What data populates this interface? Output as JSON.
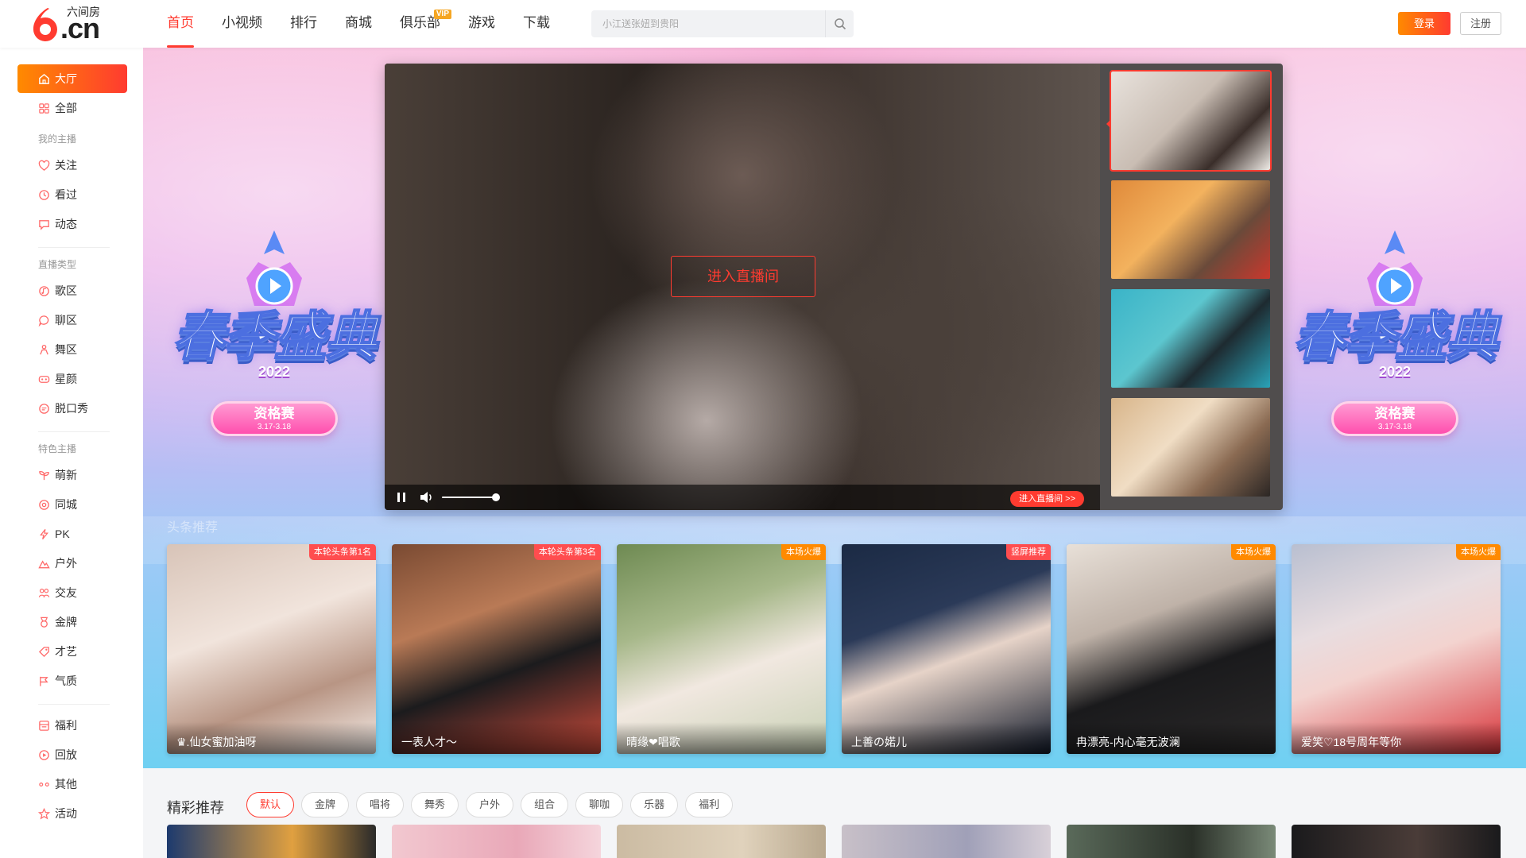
{
  "header": {
    "logo": {
      "sub": "六间房",
      "mark": ".cn"
    },
    "nav": [
      {
        "label": "首页",
        "active": true
      },
      {
        "label": "小视频"
      },
      {
        "label": "排行"
      },
      {
        "label": "商城"
      },
      {
        "label": "俱乐部",
        "badge": "VIP"
      },
      {
        "label": "游戏"
      },
      {
        "label": "下载"
      }
    ],
    "search": {
      "placeholder": "小江送张妞到贵阳"
    },
    "login": "登录",
    "register": "注册"
  },
  "sidebar": {
    "top_items": [
      {
        "label": "大厅",
        "icon": "home-icon",
        "active": true
      },
      {
        "label": "全部",
        "icon": "grid-icon"
      }
    ],
    "groups": [
      {
        "title": "我的主播",
        "items": [
          {
            "label": "关注",
            "icon": "heart-icon"
          },
          {
            "label": "看过",
            "icon": "clock-icon"
          },
          {
            "label": "动态",
            "icon": "message-icon"
          }
        ]
      },
      {
        "title": "直播类型",
        "items": [
          {
            "label": "歌区",
            "icon": "music-icon"
          },
          {
            "label": "聊区",
            "icon": "chat-icon"
          },
          {
            "label": "舞区",
            "icon": "dance-icon"
          },
          {
            "label": "星颜",
            "icon": "mask-icon"
          },
          {
            "label": "脱口秀",
            "icon": "talk-icon"
          }
        ]
      },
      {
        "title": "特色主播",
        "items": [
          {
            "label": "萌新",
            "icon": "sprout-icon"
          },
          {
            "label": "同城",
            "icon": "location-icon"
          },
          {
            "label": "PK",
            "icon": "lightning-icon"
          },
          {
            "label": "户外",
            "icon": "mountain-icon"
          },
          {
            "label": "交友",
            "icon": "friends-icon"
          },
          {
            "label": "金牌",
            "icon": "medal-icon"
          },
          {
            "label": "才艺",
            "icon": "palette-icon"
          },
          {
            "label": "气质",
            "icon": "flag-icon"
          }
        ]
      }
    ],
    "bottom_items": [
      {
        "label": "福利",
        "icon": "gift-icon"
      },
      {
        "label": "回放",
        "icon": "replay-icon"
      },
      {
        "label": "其他",
        "icon": "more-icon"
      },
      {
        "label": "活动",
        "icon": "star-icon"
      }
    ]
  },
  "hero": {
    "festival": {
      "title": "春季盛典",
      "year": "2022",
      "pill_main": "资格赛",
      "pill_date": "3.17-3.18"
    },
    "player": {
      "enter_center": "进入直播间",
      "enter_small": "进入直播间 >>",
      "volume": 0.85
    },
    "section_title": "头条推荐",
    "cards": [
      {
        "name": "♛.仙女蜜加油呀",
        "tag": "本轮头条第1名",
        "tag_color": "red"
      },
      {
        "name": "一表人才～",
        "tag": "本轮头条第3名",
        "tag_color": "red"
      },
      {
        "name": "晴缘❤唱歌",
        "tag": "本场火爆",
        "tag_color": "orange"
      },
      {
        "name": "上善の婼儿",
        "tag": "竖屏推荐",
        "tag_color": "red"
      },
      {
        "name": "冉漂亮-内心毫无波澜",
        "tag": "本场火爆",
        "tag_color": "orange"
      },
      {
        "name": "爱笑♡18号周年等你",
        "tag": "本场火爆",
        "tag_color": "orange"
      }
    ]
  },
  "recommend": {
    "title": "精彩推荐",
    "filters": [
      {
        "label": "默认",
        "active": true
      },
      {
        "label": "金牌"
      },
      {
        "label": "唱将"
      },
      {
        "label": "舞秀"
      },
      {
        "label": "户外"
      },
      {
        "label": "组合"
      },
      {
        "label": "聊咖"
      },
      {
        "label": "乐器"
      },
      {
        "label": "福利"
      }
    ]
  },
  "colors": {
    "accent": "#ff3b30",
    "accent_orange": "#ff8a00",
    "vip": "#f5a623"
  }
}
